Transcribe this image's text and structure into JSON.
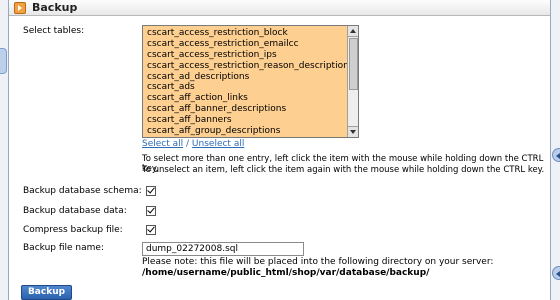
{
  "header": {
    "title": "Backup"
  },
  "tables": {
    "label": "Select tables:",
    "items": [
      "cscart_access_restriction_block",
      "cscart_access_restriction_emailcc",
      "cscart_access_restriction_ips",
      "cscart_access_restriction_reason_descriptions",
      "cscart_ad_descriptions",
      "cscart_ads",
      "cscart_aff_action_links",
      "cscart_aff_banner_descriptions",
      "cscart_aff_banners",
      "cscart_aff_group_descriptions"
    ],
    "select_all": "Select all",
    "separator": " / ",
    "unselect_all": "Unselect all",
    "hint_select": "To select more than one entry, left click the item with the mouse while holding down the CTRL key.",
    "hint_unselect": "To unselect an item, left click the item again with the mouse while holding down the CTRL key."
  },
  "options": {
    "schema_label": "Backup database schema:",
    "schema_checked": true,
    "data_label": "Backup database data:",
    "data_checked": true,
    "compress_label": "Compress backup file:",
    "compress_checked": true,
    "filename_label": "Backup file name:",
    "filename_value": "dump_02272008.sql",
    "note": "Please note: this file will be placed into the following directory on your server:",
    "path": "/home/username/public_html/shop/var/database/backup/"
  },
  "actions": {
    "backup_label": "Backup"
  },
  "colors": {
    "listbox_bg": "#fdcf91",
    "link": "#2d6bb5",
    "button": "#3a70bd"
  }
}
